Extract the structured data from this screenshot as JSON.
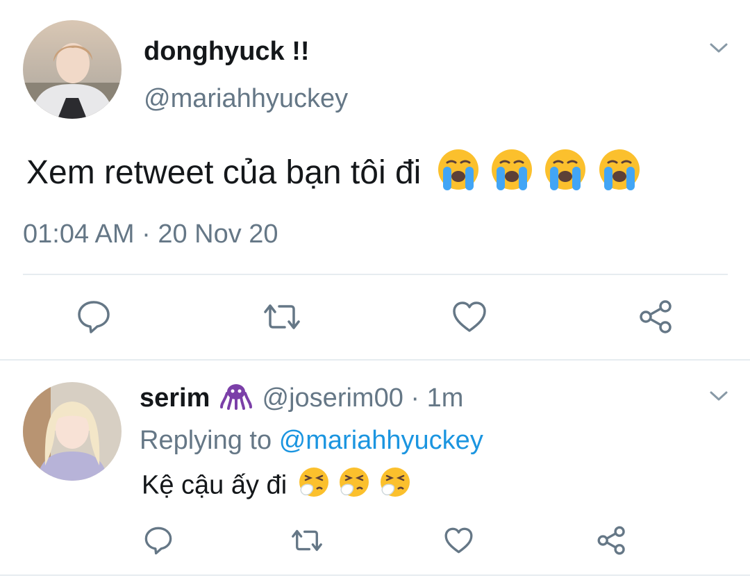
{
  "main_tweet": {
    "display_name": "donghyuck !!",
    "handle": "@mariahhyuckey",
    "text": "Xem retweet của bạn tôi đi",
    "emoji": [
      "loudly-crying-face",
      "loudly-crying-face",
      "loudly-crying-face",
      "loudly-crying-face"
    ],
    "timestamp": "01:04 AM · 20 Nov 20"
  },
  "reply": {
    "display_name": "serim",
    "name_emoji": "octopus",
    "handle": "@joserim00",
    "time": "· 1m",
    "replying_prefix": "Replying to",
    "replying_to": "@mariahhyuckey",
    "text": "Kệ cậu ấy đi",
    "emoji": [
      "sneezing-face",
      "sneezing-face",
      "sneezing-face"
    ]
  },
  "colors": {
    "text": "#14171a",
    "muted": "#657786",
    "link": "#1b95e0",
    "divider": "#e6ecf0",
    "icon": "#657786"
  }
}
